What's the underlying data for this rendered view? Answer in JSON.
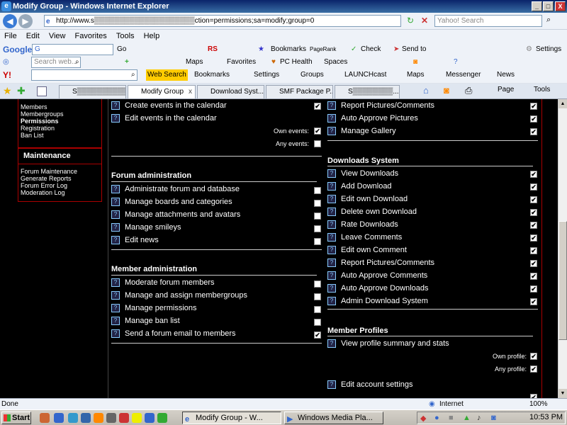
{
  "window": {
    "title": "Modify Group - Windows Internet Explorer",
    "min": "_",
    "max": "□",
    "close": "X"
  },
  "nav": {
    "back": "◀",
    "forward": "▶",
    "url": "http://www.s▒▒▒▒▒▒▒▒▒▒▒▒▒▒▒▒▒▒▒▒ction=permissions;sa=modify;group=0",
    "search_placeholder": "Yahoo! Search"
  },
  "menu": [
    "File",
    "Edit",
    "View",
    "Favorites",
    "Tools",
    "Help"
  ],
  "google_bar": {
    "logo": "Google",
    "g_input": "G",
    "go": "Go",
    "rs": "RS",
    "bookmarks": "Bookmarks",
    "pagerank": "PageRank",
    "check": "Check",
    "sendto": "Send to",
    "settings": "Settings"
  },
  "live_bar": {
    "search_placeholder": "Search web...",
    "maps": "Maps",
    "favorites": "Favorites",
    "pchealth": "PC Health",
    "spaces": "Spaces"
  },
  "yahoo_bar": {
    "logo": "Y!",
    "websearch": "Web Search",
    "bookmarks": "Bookmarks",
    "settings": "Settings",
    "groups": "Groups",
    "launchcast": "LAUNCHcast",
    "maps": "Maps",
    "messenger": "Messenger",
    "news": "News"
  },
  "tabs": [
    {
      "label": "S▒▒▒▒▒▒▒▒▒▒▒"
    },
    {
      "label": "Modify Group",
      "close": "x"
    },
    {
      "label": "Download Syst..."
    },
    {
      "label": "SMF Package P..."
    },
    {
      "label": "S▒▒▒▒▒▒▒▒..."
    }
  ],
  "tab_tools": {
    "page": "Page",
    "tools": "Tools"
  },
  "sidebar": {
    "members_items": [
      "Members",
      "Membergroups",
      "Permissions",
      "Registration",
      "Ban List"
    ],
    "maintenance_title": "Maintenance",
    "maintenance_items": [
      "Forum Maintenance",
      "Generate Reports",
      "Forum Error Log",
      "Moderation Log"
    ]
  },
  "left_col": {
    "calendar": [
      "Create events in the calendar",
      "Edit events in the calendar"
    ],
    "own_events": "Own events:",
    "any_events": "Any events:",
    "forum_admin_title": "Forum administration",
    "forum_admin": [
      "Administrate forum and database",
      "Manage boards and categories",
      "Manage attachments and avatars",
      "Manage smileys",
      "Edit news"
    ],
    "member_admin_title": "Member administration",
    "member_admin": [
      "Moderate forum members",
      "Manage and assign membergroups",
      "Manage permissions",
      "Manage ban list",
      "Send a forum email to members"
    ]
  },
  "right_col": {
    "gallery": [
      "Report Pictures/Comments",
      "Auto Approve Pictures",
      "Manage Gallery"
    ],
    "downloads_title": "Downloads System",
    "downloads": [
      "View Downloads",
      "Add Download",
      "Edit own Download",
      "Delete own Download",
      "Rate Downloads",
      "Leave Comments",
      "Edit own Comment",
      "Report Pictures/Comments",
      "Auto Approve Comments",
      "Auto Approve Downloads",
      "Admin Download System"
    ],
    "profiles_title": "Member Profiles",
    "profiles": [
      "View profile summary and stats"
    ],
    "own_profile": "Own profile:",
    "any_profile": "Any profile:",
    "edit_account": "Edit account settings"
  },
  "check_mark": "✔",
  "status": {
    "text": "Done",
    "zone": "Internet",
    "zoom": "100%"
  },
  "taskbar": {
    "start": "Start",
    "task1": "Modify Group - W...",
    "task2": "Windows Media Pla...",
    "clock": "10:53 PM"
  }
}
